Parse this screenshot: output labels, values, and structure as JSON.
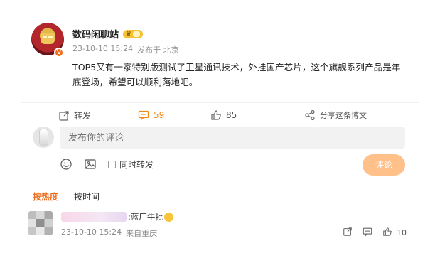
{
  "post": {
    "author": "数码闲聊站",
    "time": "23-10-10 15:24",
    "source": "发布于 北京",
    "text": "TOP5又有一家特别版测试了卫星通讯技术，外挂国产芯片，这个旗舰系列产品是年底登场，希望可以顺利落地吧。",
    "repost_label": "转发",
    "comment_count": "59",
    "like_count": "85",
    "share_label": "分享这条博文"
  },
  "composer": {
    "placeholder": "发布你的评论",
    "repost_option": "同时转发",
    "submit_label": "评论"
  },
  "tabs": {
    "hot": "按热度",
    "time": "按时间"
  },
  "comment": {
    "text": ":蓝厂牛批",
    "time": "23-10-10 15:24",
    "location": "来自重庆",
    "like_count": "10"
  },
  "colors": {
    "accent": "#f06a1a",
    "comment_count": "#f28a1a",
    "submit_bg": "#ffc08a"
  }
}
